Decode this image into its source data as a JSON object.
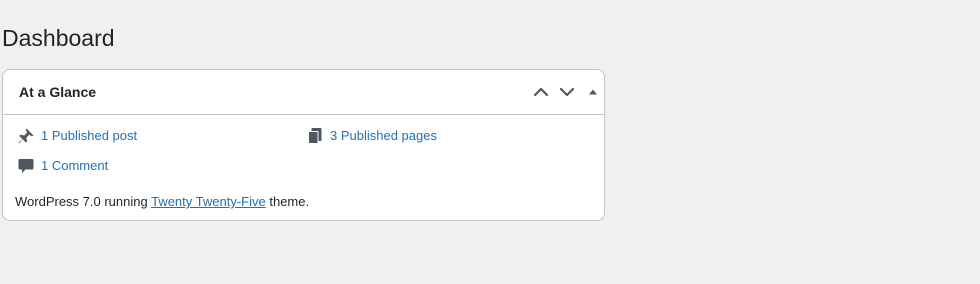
{
  "page": {
    "title": "Dashboard"
  },
  "widget": {
    "title": "At a Glance",
    "controls": {
      "move_up": "chevron-up-icon",
      "move_down": "chevron-down-icon",
      "toggle": "triangle-up-icon"
    },
    "items": [
      {
        "icon": "pushpin-icon",
        "label": "1 Published post"
      },
      {
        "icon": "pages-icon",
        "label": "3 Published pages"
      },
      {
        "icon": "comment-icon",
        "label": "1 Comment"
      }
    ],
    "running": {
      "prefix": "WordPress 7.0 running ",
      "theme_link": "Twenty Twenty-Five",
      "suffix": " theme."
    }
  },
  "colors": {
    "background": "#f0f0f1",
    "link": "#2271b1",
    "icon": "#50575e",
    "border": "#c3c4c7",
    "text": "#1d2327"
  }
}
